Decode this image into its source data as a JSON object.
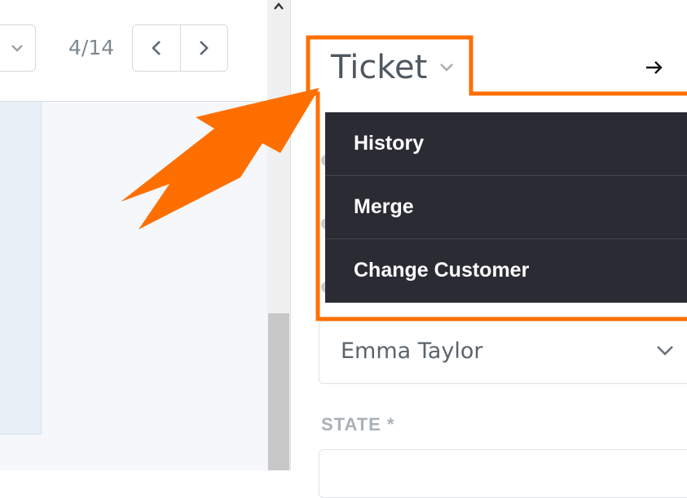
{
  "pager": {
    "position_text": "4/14",
    "prev_icon": "chevron-left-icon",
    "next_icon": "chevron-right-icon",
    "partial_button_icon": "chevron-down-icon"
  },
  "ticket": {
    "title": "Ticket",
    "title_caret_icon": "chevron-down-icon",
    "forward_icon": "arrow-right-icon"
  },
  "menu": {
    "items": [
      {
        "label": "History"
      },
      {
        "label": "Merge"
      },
      {
        "label": "Change Customer"
      }
    ]
  },
  "form": {
    "customer_value": "Emma Taylor",
    "state_label": "STATE *"
  },
  "colors": {
    "highlight": "#ff6f00",
    "menu_background": "#2b2c33",
    "menu_text": "#ffffff"
  }
}
